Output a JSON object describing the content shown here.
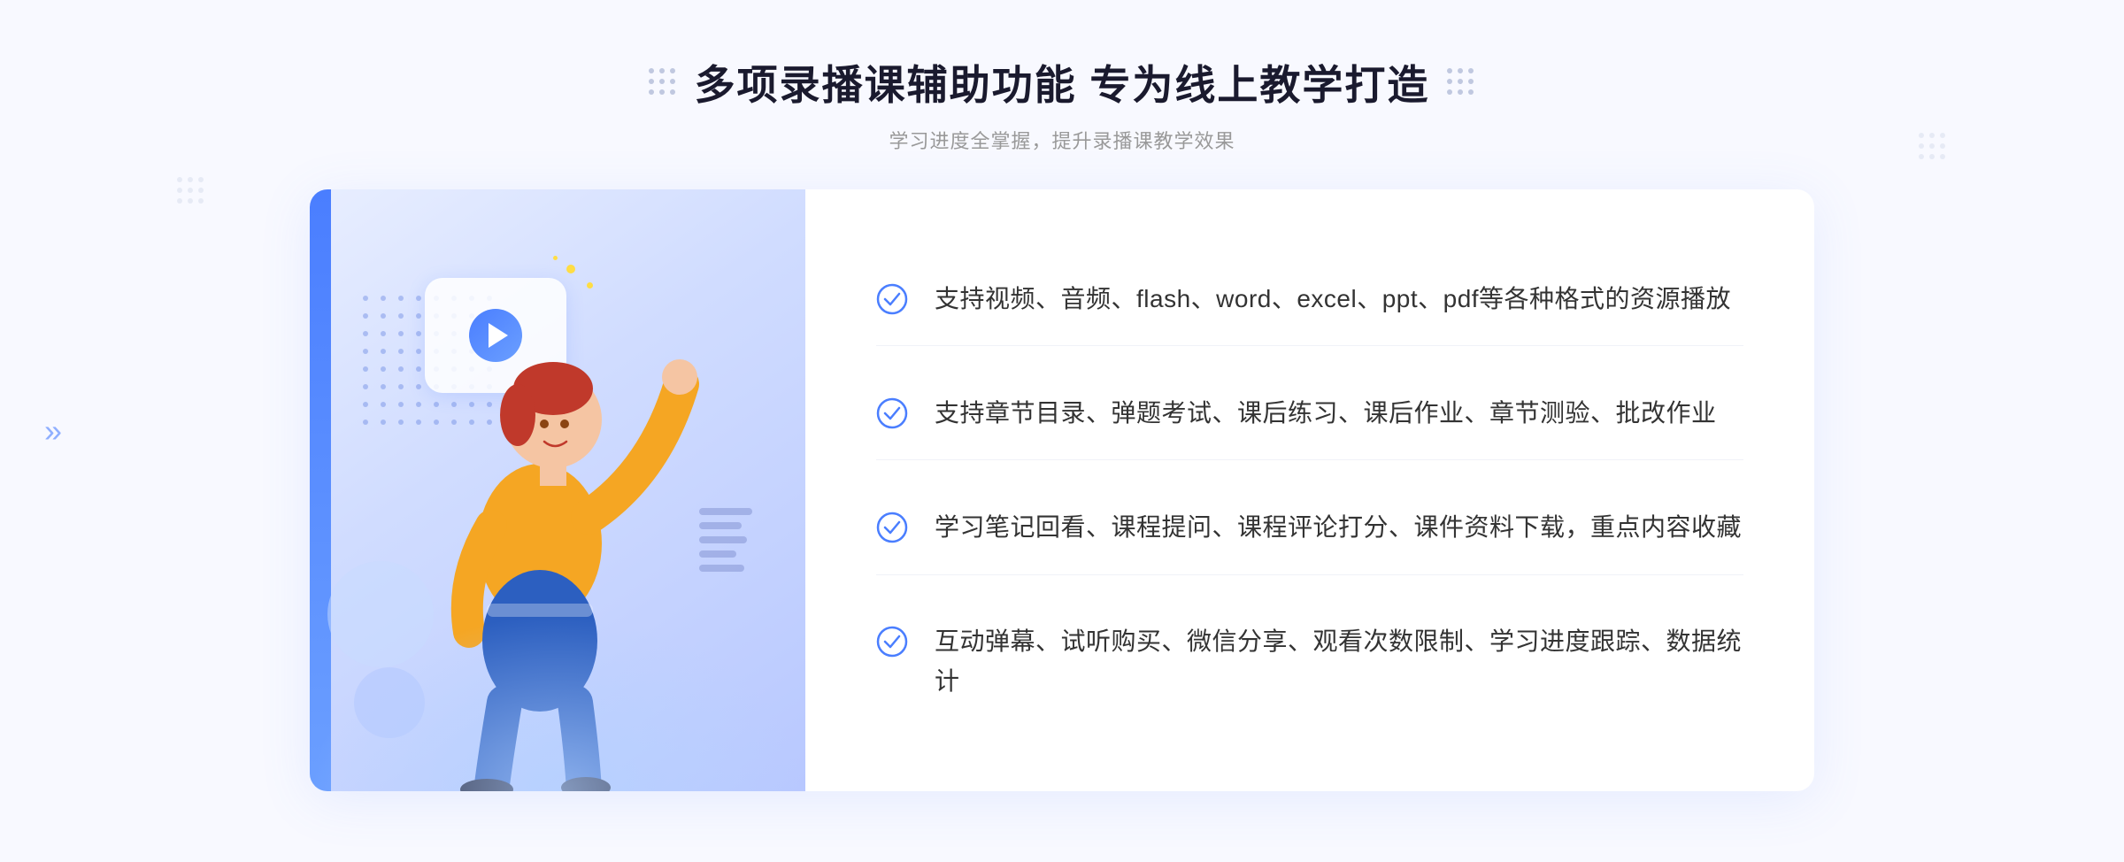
{
  "header": {
    "title": "多项录播课辅助功能 专为线上教学打造",
    "subtitle": "学习进度全掌握，提升录播课教学效果"
  },
  "features": [
    {
      "id": 1,
      "text": "支持视频、音频、flash、word、excel、ppt、pdf等各种格式的资源播放"
    },
    {
      "id": 2,
      "text": "支持章节目录、弹题考试、课后练习、课后作业、章节测验、批改作业"
    },
    {
      "id": 3,
      "text": "学习笔记回看、课程提问、课程评论打分、课件资料下载，重点内容收藏"
    },
    {
      "id": 4,
      "text": "互动弹幕、试听购买、微信分享、观看次数限制、学习进度跟踪、数据统计"
    }
  ],
  "icons": {
    "check": "✓",
    "arrow_right": "»",
    "play": "▶"
  },
  "colors": {
    "primary": "#4a7eff",
    "text_dark": "#1a1a2e",
    "text_gray": "#999999",
    "bg_light": "#f8f9ff",
    "accent": "#ffd700"
  }
}
